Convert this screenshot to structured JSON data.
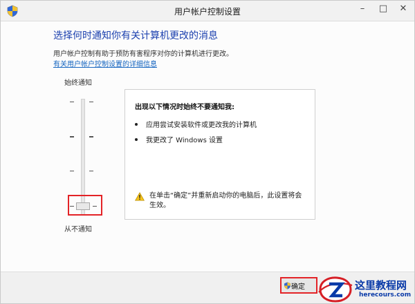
{
  "window": {
    "title": "用户帐户控制设置"
  },
  "titlebar_buttons": {
    "minimize": "–",
    "maximize": "□",
    "close": "✕"
  },
  "main": {
    "heading": "选择何时通知你有关计算机更改的消息",
    "description": "用户帐户控制有助于预防有害程序对你的计算机进行更改。",
    "link": "有关用户帐户控制设置的详细信息"
  },
  "slider": {
    "top_label": "始终通知",
    "bottom_label": "从不通知",
    "level_index": 0,
    "level_count": 4
  },
  "panel": {
    "title": "出现以下情况时始终不要通知我:",
    "bullets": [
      "应用尝试安装软件或更改我的计算机",
      "我更改了 Windows 设置"
    ],
    "warning": "在单击“确定”并重新启动你的电脑后，此设置将会生效。"
  },
  "footer": {
    "ok_label": "确定"
  },
  "watermark": {
    "name": "这里教程网",
    "url": "herecours.com"
  },
  "icons": {
    "app": "uac-shield-icon",
    "warning": "warning-triangle-icon",
    "ok": "uac-shield-icon"
  },
  "colors": {
    "heading": "#1a3fae",
    "link": "#1565c0",
    "highlight": "#e32226"
  }
}
